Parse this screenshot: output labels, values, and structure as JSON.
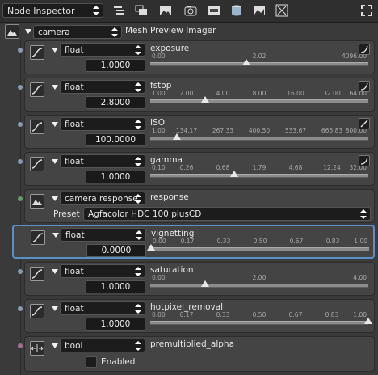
{
  "toolbar": {
    "panel_name": "Node Inspector",
    "icons": [
      "list-indent-icon",
      "layers-icon",
      "image-icon",
      "camera-settings-icon",
      "film-strip-icon",
      "database-icon",
      "picture-icon",
      "grid-icon",
      "expand-icon"
    ]
  },
  "root": {
    "node_type": "camera",
    "node_name": "Mesh Preview Imager"
  },
  "params": [
    {
      "type": "float",
      "name": "exposure",
      "value": "1.0000",
      "ticks": [
        "0.00",
        "2.02",
        "4096.00"
      ],
      "thumb": 0.44,
      "curve": "curve-s"
    },
    {
      "type": "float",
      "name": "fstop",
      "value": "2.8000",
      "ticks": [
        "1.00",
        "2.00",
        "4.00",
        "8.00",
        "16.00",
        "32.00",
        "64.00"
      ],
      "thumb": 0.25,
      "curve": "curve-s"
    },
    {
      "type": "float",
      "name": "ISO",
      "value": "100.0000",
      "ticks": [
        "1.00",
        "134.17",
        "267.33",
        "400.50",
        "533.67",
        "666.83",
        "800.00"
      ],
      "thumb": 0.124,
      "curve": "curve-linear"
    },
    {
      "type": "float",
      "name": "gamma",
      "value": "1.0000",
      "ticks": [
        "0.10",
        "0.26",
        "0.68",
        "1.79",
        "4.68",
        "12.24",
        "32.00"
      ],
      "thumb": 0.385,
      "curve": "curve-s"
    },
    {
      "type": "float",
      "name": "vignetting",
      "value": "0.0000",
      "ticks": [
        "0.00",
        "0.17",
        "0.33",
        "0.50",
        "0.67",
        "0.83",
        "1.00"
      ],
      "thumb": 0.0,
      "curve": ""
    },
    {
      "type": "float",
      "name": "saturation",
      "value": "1.0000",
      "ticks": [
        "0.00",
        "2.00",
        "4.00"
      ],
      "thumb": 0.25,
      "curve": ""
    },
    {
      "type": "float",
      "name": "hotpixel_removal",
      "value": "1.0000",
      "ticks": [
        "0.00",
        "0.17",
        "0.33",
        "0.50",
        "0.67",
        "0.83",
        "1.00"
      ],
      "thumb": 1.0,
      "curve": ""
    }
  ],
  "response": {
    "type": "camera response",
    "name": "response",
    "preset_label": "Preset",
    "preset_value": "Agfacolor HDC 100 plusCD"
  },
  "premult": {
    "type": "bool",
    "name": "premultiplied_alpha",
    "checkbox_label": "Enabled",
    "checked": false
  },
  "colors": {
    "selected_border": "#5a8fc8",
    "dot_float": "#8a9ab0",
    "dot_response": "#6a9a6a",
    "dot_bool": "#a07090"
  }
}
